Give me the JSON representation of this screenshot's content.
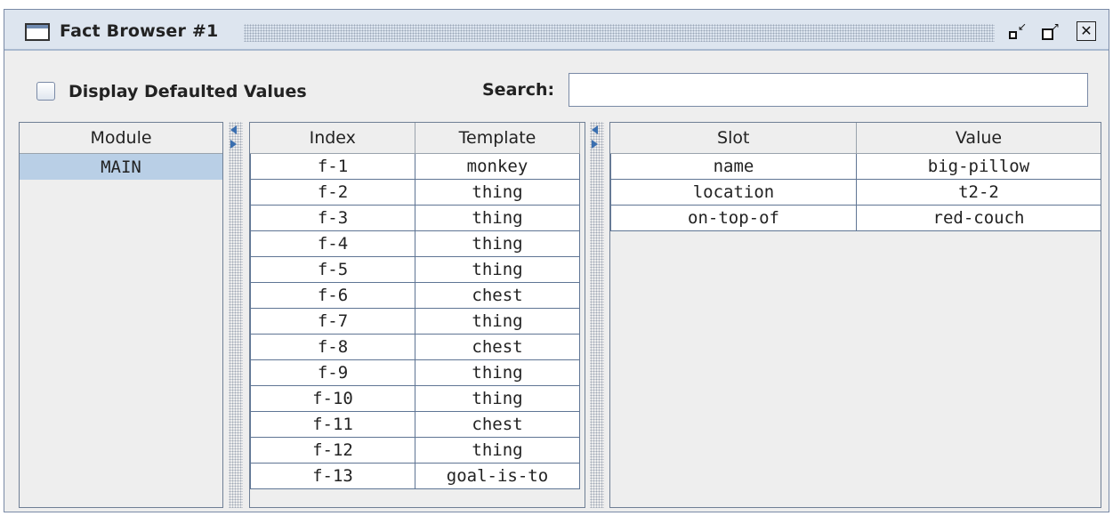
{
  "window": {
    "title": "Fact Browser #1",
    "buttons": [
      "minimize-icon",
      "maximize-icon",
      "close-icon"
    ]
  },
  "options": {
    "display_defaulted_label": "Display Defaulted Values",
    "display_defaulted_checked": false,
    "search_label": "Search:",
    "search_value": ""
  },
  "modules": {
    "header": "Module",
    "items": [
      "MAIN"
    ],
    "selected": "MAIN"
  },
  "facts": {
    "headers": [
      "Index",
      "Template"
    ],
    "rows": [
      [
        "f-1",
        "monkey"
      ],
      [
        "f-2",
        "thing"
      ],
      [
        "f-3",
        "thing"
      ],
      [
        "f-4",
        "thing"
      ],
      [
        "f-5",
        "thing"
      ],
      [
        "f-6",
        "chest"
      ],
      [
        "f-7",
        "thing"
      ],
      [
        "f-8",
        "chest"
      ],
      [
        "f-9",
        "thing"
      ],
      [
        "f-10",
        "thing"
      ],
      [
        "f-11",
        "chest"
      ],
      [
        "f-12",
        "thing"
      ],
      [
        "f-13",
        "goal-is-to"
      ]
    ]
  },
  "slots": {
    "headers": [
      "Slot",
      "Value"
    ],
    "rows": [
      [
        "name",
        "big-pillow"
      ],
      [
        "location",
        "t2-2"
      ],
      [
        "on-top-of",
        "red-couch"
      ]
    ]
  },
  "colors": {
    "titlebar": "#dde5ef",
    "selection": "#b9cfe6",
    "border": "#5f7594"
  }
}
